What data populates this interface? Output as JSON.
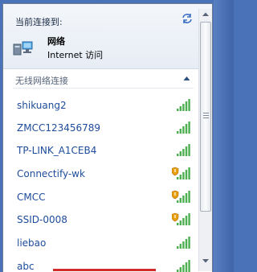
{
  "header": {
    "title": "当前连接到:",
    "connected_network": {
      "name": "网络",
      "status": "Internet 访问"
    }
  },
  "section": {
    "title": "无线网络连接"
  },
  "networks": [
    {
      "name": "shikuang2",
      "signal": 5,
      "warning": false
    },
    {
      "name": "ZMCC123456789",
      "signal": 5,
      "warning": false
    },
    {
      "name": "TP-LINK_A1CEB4",
      "signal": 5,
      "warning": false
    },
    {
      "name": "Connectify-wk",
      "signal": 5,
      "warning": true
    },
    {
      "name": "CMCC",
      "signal": 5,
      "warning": true
    },
    {
      "name": "SSID-0008",
      "signal": 5,
      "warning": true
    },
    {
      "name": "liebao",
      "signal": 5,
      "warning": false
    },
    {
      "name": "abc",
      "signal": 5,
      "warning": false
    }
  ],
  "icons": {
    "refresh": "refresh-icon",
    "network": "network-computer-icon",
    "signal": "wifi-signal-icon",
    "collapse": "chevron-up-icon"
  },
  "colors": {
    "link": "#1e4c9a",
    "signal": "#4caf50",
    "warning": "#e8a010"
  }
}
